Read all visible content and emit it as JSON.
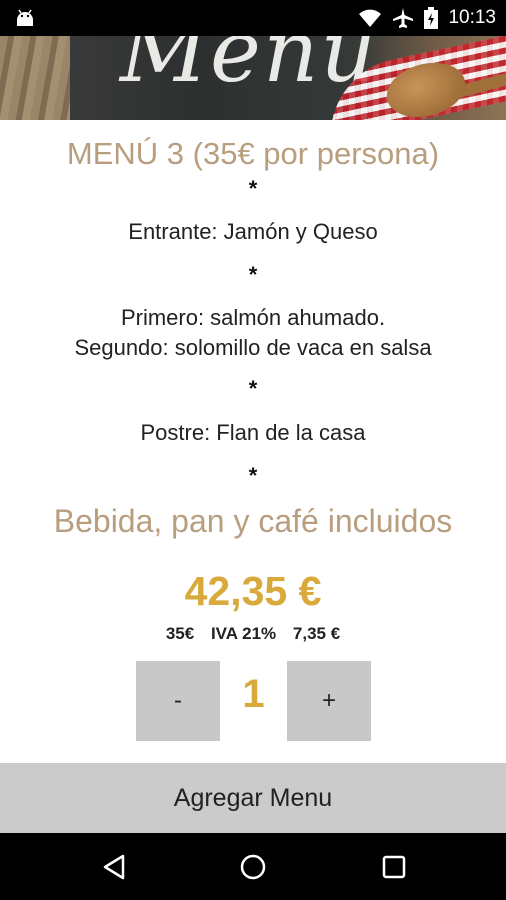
{
  "status_bar": {
    "time": "10:13",
    "icons": [
      "android-icon",
      "wifi-icon",
      "airplane-icon",
      "battery-icon"
    ]
  },
  "header": {
    "image_text": "Menu"
  },
  "menu": {
    "title": "MENÚ 3  (35€ por persona)",
    "separator": "*",
    "starter": "Entrante: Jamón y Queso",
    "first": "Primero: salmón ahumado.",
    "second": "Segundo: solomillo de vaca en salsa",
    "dessert": "Postre: Flan de la casa",
    "included": "Bebida, pan y café incluidos"
  },
  "pricing": {
    "total": "42,35 €",
    "base": "35€",
    "tax_label": "IVA 21%",
    "tax_amount": "7,35 €"
  },
  "quantity": {
    "minus": "-",
    "value": "1",
    "plus": "+"
  },
  "actions": {
    "add_label": "Agregar Menu"
  },
  "colors": {
    "title": "#b89e7e",
    "price": "#d9a93b",
    "button_bg": "#c8c8c8"
  },
  "nav": [
    "back-icon",
    "home-icon",
    "recents-icon"
  ]
}
